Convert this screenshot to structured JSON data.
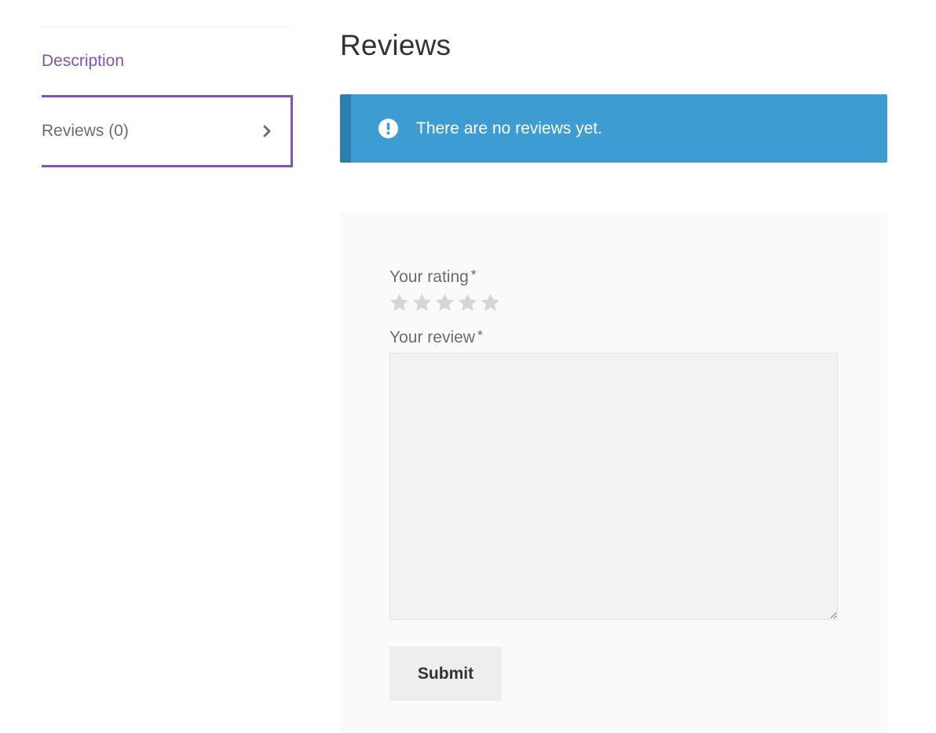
{
  "tabs": {
    "items": [
      {
        "label": "Description",
        "active": false
      },
      {
        "label": "Reviews (0)",
        "active": true
      }
    ]
  },
  "main": {
    "title": "Reviews",
    "notice": "There are no reviews yet."
  },
  "form": {
    "rating_label": "Your rating",
    "review_label": "Your review",
    "required_mark": "*",
    "review_value": "",
    "rating_value": 0,
    "rating_max": 5,
    "submit_label": "Submit"
  },
  "icons": {
    "notice": "info-circle-icon",
    "tab_arrow": "chevron-right-icon",
    "star": "star-icon"
  },
  "colors": {
    "accent": "#7f54b3",
    "notice_bg": "#3d9cd2",
    "notice_border": "#2c7fae",
    "required": "#a94442",
    "star_empty": "#d6d6d6"
  }
}
